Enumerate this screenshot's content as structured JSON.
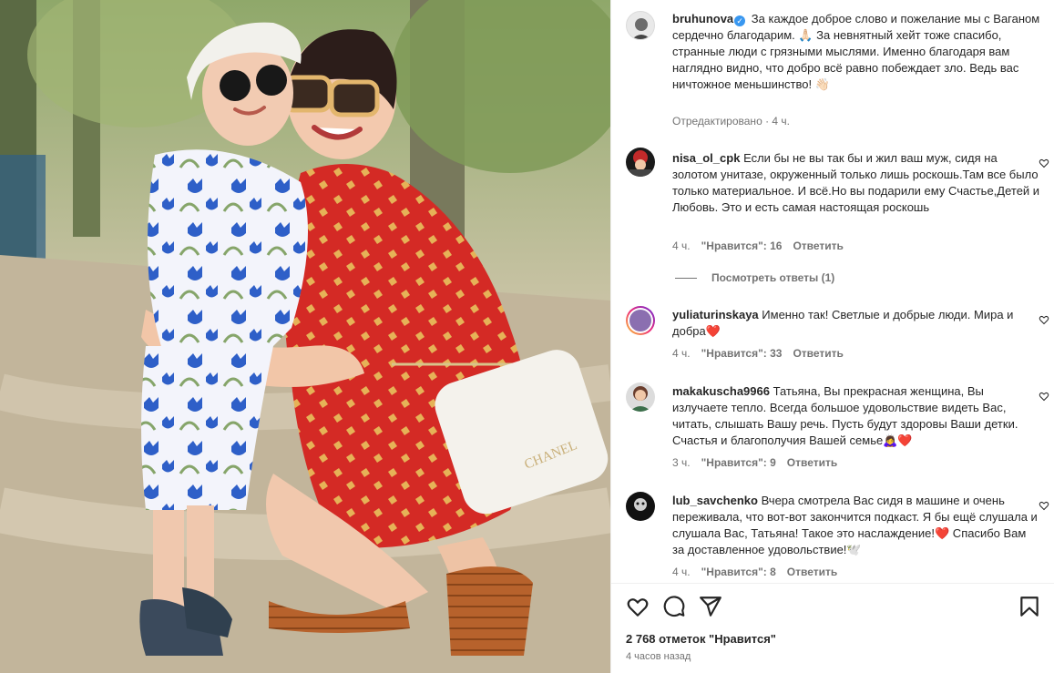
{
  "post": {
    "author": "bruhunova",
    "caption": "За каждое доброе слово и пожелание мы с Ваганом сердечно благодарим. 🙏🏻 За невнятный хейт тоже спасибо, странные люди с грязными мыслями. Именно благодаря вам наглядно видно, что добро всё равно побеждает зло. Ведь вас ничтожное меньшинство! 👋🏻",
    "edited": "Отредактировано",
    "time": "4 ч."
  },
  "comments": [
    {
      "user": "nisa_ol_cpk",
      "text": "Если бы не вы так бы и жил ваш муж, сидя на золотом унитазе, окруженный только лишь роскошь.Там все было только материальное. И всё.Но вы подарили ему Счастье,Детей и Любовь. Это и есть самая настоящая роскошь",
      "time": "4 ч.",
      "likes": "\"Нравится\": 16",
      "reply": "Ответить",
      "view_replies": "Посмотреть ответы (1)"
    },
    {
      "user": "yuliaturinskaya",
      "text": "Именно так! Светлые и добрые люди. Мира и добра❤️",
      "time": "4 ч.",
      "likes": "\"Нравится\": 33",
      "reply": "Ответить"
    },
    {
      "user": "makakuscha9966",
      "text": "Татьяна, Вы прекрасная женщина, Вы излучаете тепло. Всегда большое удовольствие видеть Вас, читать, слышать Вашу речь. Пусть будут здоровы Ваши детки. Счастья и благополучия Вашей семье🙇‍♀️❤️",
      "time": "3 ч.",
      "likes": "\"Нравится\": 9",
      "reply": "Ответить"
    },
    {
      "user": "lub_savchenko",
      "text": "Вчера смотрела Вас сидя в машине и очень переживала, что вот-вот закончится подкаст. Я бы ещё слушала и слушала Вас, Татьяна! Такое это наслаждение!❤️ Спасибо Вам за доставленное удовольствие!🕊️",
      "time": "4 ч.",
      "likes": "\"Нравится\": 8",
      "reply": "Ответить"
    }
  ],
  "footer": {
    "likes": "2 768 отметок \"Нравится\"",
    "ago": "4 часов назад"
  },
  "photo_logo": "CHANEL",
  "icons": [
    "heart-icon",
    "comment-icon",
    "share-icon",
    "bookmark-icon",
    "verified-icon"
  ],
  "colors": {
    "dress": "#d42a25",
    "accent": "#3897f0",
    "secondary_text": "#737373"
  }
}
